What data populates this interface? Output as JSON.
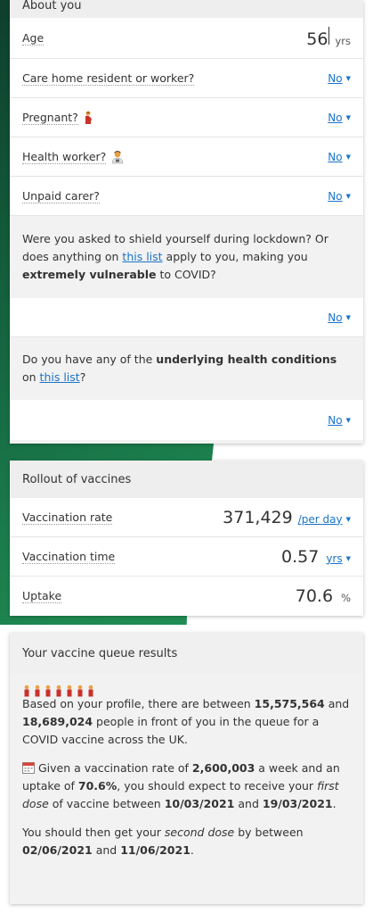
{
  "about": {
    "header": "About you",
    "age": {
      "label": "Age",
      "value": "56",
      "unit": "yrs"
    },
    "care_home": {
      "label": "Care home resident or worker?",
      "value": "No"
    },
    "pregnant": {
      "label": "Pregnant?",
      "value": "No",
      "icon": "pregnant-woman-icon"
    },
    "health_worker": {
      "label": "Health worker?",
      "value": "No",
      "icon": "health-worker-icon"
    },
    "unpaid_carer": {
      "label": "Unpaid carer?",
      "value": "No"
    },
    "shield": {
      "text_a": "Were you asked to shield yourself during lockdown? Or does anything on ",
      "link": "this list",
      "text_b": " apply to you, making you ",
      "bold": "extremely vulnerable",
      "text_c": " to COVID?",
      "value": "No"
    },
    "conditions": {
      "text_a": "Do you have any of the ",
      "bold": "underlying health conditions",
      "text_b": " on ",
      "link": "this list",
      "text_c": "?",
      "value": "No"
    }
  },
  "rollout": {
    "header": "Rollout of vaccines",
    "rate": {
      "label": "Vaccination rate",
      "value": "371,429",
      "unit": "/per day"
    },
    "time": {
      "label": "Vaccination time",
      "value": "0.57",
      "unit": "yrs"
    },
    "uptake": {
      "label": "Uptake",
      "value": "70.6",
      "unit": "%"
    }
  },
  "results": {
    "header": "Your vaccine queue results",
    "queue_icon": "people-queue-icon",
    "p1": {
      "a": "Based on your profile, there are between ",
      "low": "15,575,564",
      "b": " and ",
      "high": "18,689,024",
      "c": " people in front of you in the queue for a COVID vaccine across the UK."
    },
    "p2": {
      "icon": "calendar-icon",
      "a": " Given a vaccination rate of ",
      "rate": "2,600,003",
      "b": " a week and an uptake of ",
      "uptake": "70.6%",
      "c": ", you should expect to receive your ",
      "first_dose": "first dose",
      "d": " of vaccine between ",
      "from": "10/03/2021",
      "e": " and ",
      "to": "19/03/2021",
      "f": "."
    },
    "p3": {
      "a": "You should then get your ",
      "second_dose": "second dose",
      "b": " by between ",
      "from": "02/06/2021",
      "c": " and ",
      "to": "11/06/2021",
      "d": "."
    }
  },
  "colors": {
    "link": "#1a73c8",
    "green_dark": "#0e3f2c",
    "green_light": "#2a9b5d"
  }
}
